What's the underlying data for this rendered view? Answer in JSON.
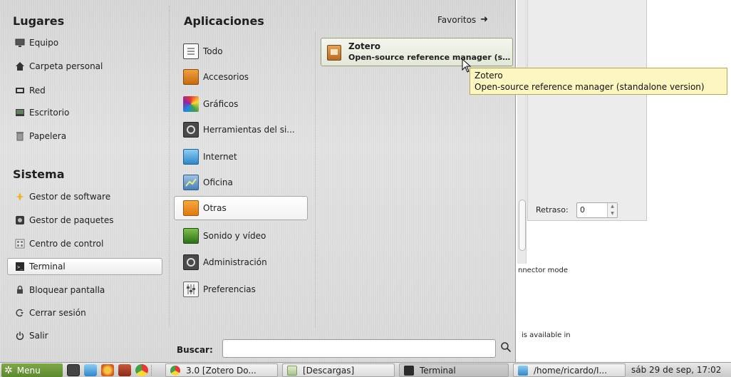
{
  "menu": {
    "places_title": "Lugares",
    "places": [
      {
        "label": "Equipo",
        "icon": "computer-icon"
      },
      {
        "label": "Carpeta personal",
        "icon": "home-icon"
      },
      {
        "label": "Red",
        "icon": "network-icon"
      },
      {
        "label": "Escritorio",
        "icon": "desktop-icon"
      },
      {
        "label": "Papelera",
        "icon": "trash-icon"
      }
    ],
    "system_title": "Sistema",
    "system": [
      {
        "label": "Gestor de software",
        "icon": "software-manager-icon"
      },
      {
        "label": "Gestor de paquetes",
        "icon": "package-manager-icon"
      },
      {
        "label": "Centro de control",
        "icon": "control-center-icon"
      },
      {
        "label": "Terminal",
        "icon": "terminal-icon"
      },
      {
        "label": "Bloquear pantalla",
        "icon": "lock-icon"
      },
      {
        "label": "Cerrar sesión",
        "icon": "logout-icon"
      },
      {
        "label": "Salir",
        "icon": "power-icon"
      }
    ],
    "apps_title": "Aplicaciones",
    "favorites_label": "Favoritos",
    "categories": [
      {
        "label": "Todo",
        "icon": "all-apps-icon"
      },
      {
        "label": "Accesorios",
        "icon": "accessories-icon"
      },
      {
        "label": "Gráficos",
        "icon": "graphics-icon"
      },
      {
        "label": "Herramientas del si...",
        "icon": "system-tools-icon"
      },
      {
        "label": "Internet",
        "icon": "internet-icon"
      },
      {
        "label": "Oficina",
        "icon": "office-icon"
      },
      {
        "label": "Otras",
        "icon": "other-icon"
      },
      {
        "label": "Sonido y vídeo",
        "icon": "sound-video-icon"
      },
      {
        "label": "Administración",
        "icon": "administration-icon"
      },
      {
        "label": "Preferencias",
        "icon": "preferences-icon"
      }
    ],
    "selected_category": "Otras",
    "app_result": {
      "name": "Zotero",
      "description": "Open-source reference manager (st..."
    },
    "tooltip": {
      "line1": "Zotero",
      "line2": "Open-source reference manager (standalone version)"
    },
    "search": {
      "label": "Buscar:",
      "value": "",
      "placeholder": ""
    }
  },
  "background_window": {
    "retraso_label": "Retraso:",
    "retraso_value": "0",
    "text_1": "nnector mode",
    "text_2": "is available in"
  },
  "taskbar": {
    "menu_label": "Menu",
    "tasks": [
      {
        "label": "3.0 [Zotero Do...",
        "icon": "chrome-icon"
      },
      {
        "label": "[Descargas]",
        "icon": "folder-icon"
      },
      {
        "label": "Terminal",
        "icon": "terminal-icon"
      },
      {
        "label": "/home/ricardo/I...",
        "icon": "file-manager-icon"
      }
    ],
    "clock": "sáb 29 de sep, 17:02"
  },
  "colors": {
    "accent_green": "#6f9b3d",
    "tooltip_bg": "#fcf6c0"
  }
}
